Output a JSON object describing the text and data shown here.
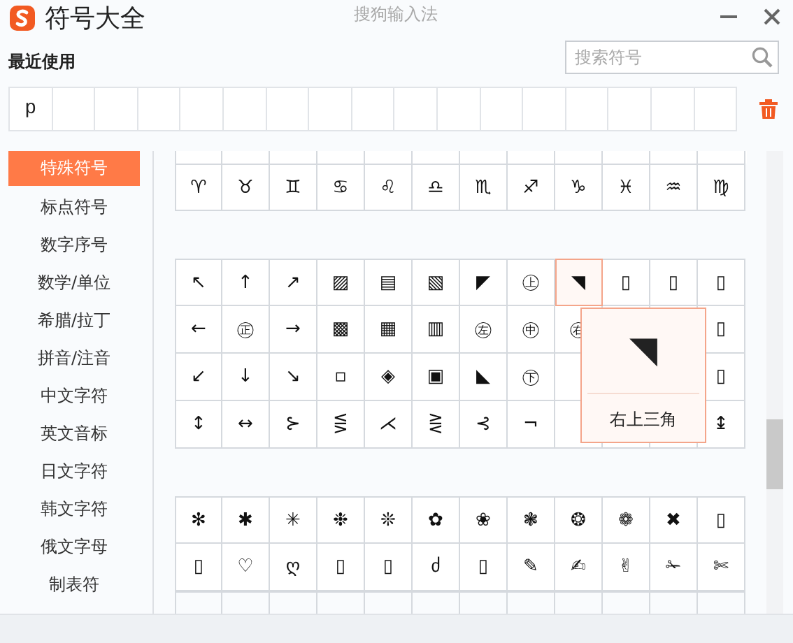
{
  "window": {
    "title": "符号大全",
    "app_name": "搜狗输入法"
  },
  "recent": {
    "label": "最近使用",
    "symbols": [
      "p"
    ]
  },
  "search": {
    "placeholder": "搜索符号"
  },
  "sidebar": {
    "items": [
      {
        "label": "特殊符号",
        "selected": true
      },
      {
        "label": "标点符号",
        "selected": false
      },
      {
        "label": "数字序号",
        "selected": false
      },
      {
        "label": "数学/单位",
        "selected": false
      },
      {
        "label": "希腊/拉丁",
        "selected": false
      },
      {
        "label": "拼音/注音",
        "selected": false
      },
      {
        "label": "中文字符",
        "selected": false
      },
      {
        "label": "英文音标",
        "selected": false
      },
      {
        "label": "日文字符",
        "selected": false
      },
      {
        "label": "韩文字符",
        "selected": false
      },
      {
        "label": "俄文字母",
        "selected": false
      },
      {
        "label": "制表符",
        "selected": false
      }
    ]
  },
  "sections": [
    {
      "rows": [
        [
          {
            "symbol": "♈",
            "selected": false
          },
          {
            "symbol": "♉",
            "selected": false
          },
          {
            "symbol": "♊",
            "selected": false
          },
          {
            "symbol": "♋",
            "selected": false
          },
          {
            "symbol": "♌",
            "selected": false
          },
          {
            "symbol": "♎",
            "selected": false
          },
          {
            "symbol": "♏",
            "selected": false
          },
          {
            "symbol": "♐",
            "selected": false
          },
          {
            "symbol": "♑",
            "selected": false
          },
          {
            "symbol": "♓",
            "selected": false
          },
          {
            "symbol": "♒",
            "selected": false
          },
          {
            "symbol": "♍",
            "selected": false
          }
        ]
      ]
    },
    {
      "rows": [
        [
          {
            "symbol": "↖",
            "selected": false
          },
          {
            "symbol": "↑",
            "selected": false
          },
          {
            "symbol": "↗",
            "selected": false
          },
          {
            "symbol": "▨",
            "selected": false
          },
          {
            "symbol": "▤",
            "selected": false
          },
          {
            "symbol": "▧",
            "selected": false
          },
          {
            "symbol": "◤",
            "selected": false
          },
          {
            "symbol": "㊤",
            "selected": false
          },
          {
            "symbol": "◥",
            "selected": true
          },
          {
            "symbol": "▯",
            "selected": false
          },
          {
            "symbol": "▯",
            "selected": false
          },
          {
            "symbol": "▯",
            "selected": false
          }
        ],
        [
          {
            "symbol": "←",
            "selected": false
          },
          {
            "symbol": "㊣",
            "selected": false
          },
          {
            "symbol": "→",
            "selected": false
          },
          {
            "symbol": "▩",
            "selected": false
          },
          {
            "symbol": "▦",
            "selected": false
          },
          {
            "symbol": "▥",
            "selected": false
          },
          {
            "symbol": "㊧",
            "selected": false
          },
          {
            "symbol": "㊥",
            "selected": false
          },
          {
            "symbol": "㊨",
            "selected": false
          },
          null,
          null,
          {
            "symbol": "▯",
            "selected": false
          }
        ],
        [
          {
            "symbol": "↙",
            "selected": false
          },
          {
            "symbol": "↓",
            "selected": false
          },
          {
            "symbol": "↘",
            "selected": false
          },
          {
            "symbol": "▫",
            "selected": false
          },
          {
            "symbol": "◈",
            "selected": false
          },
          {
            "symbol": "▣",
            "selected": false
          },
          {
            "symbol": "◣",
            "selected": false
          },
          {
            "symbol": "㊦",
            "selected": false
          },
          null,
          null,
          null,
          {
            "symbol": "▯",
            "selected": false
          }
        ],
        [
          {
            "symbol": "↕",
            "selected": false
          },
          {
            "symbol": "↔",
            "selected": false
          },
          {
            "symbol": "⊱",
            "selected": false
          },
          {
            "symbol": "⋚",
            "selected": false
          },
          {
            "symbol": "⋌",
            "selected": false
          },
          {
            "symbol": "⋛",
            "selected": false
          },
          {
            "symbol": "⊰",
            "selected": false
          },
          {
            "symbol": "¬",
            "selected": false
          },
          null,
          null,
          null,
          {
            "symbol": "↨",
            "selected": false
          }
        ]
      ]
    },
    {
      "rows": [
        [
          {
            "symbol": "✻",
            "selected": false
          },
          {
            "symbol": "✱",
            "selected": false
          },
          {
            "symbol": "✳",
            "selected": false
          },
          {
            "symbol": "❉",
            "selected": false
          },
          {
            "symbol": "❊",
            "selected": false
          },
          {
            "symbol": "✿",
            "selected": false
          },
          {
            "symbol": "❀",
            "selected": false
          },
          {
            "symbol": "❃",
            "selected": false
          },
          {
            "symbol": "❂",
            "selected": false
          },
          {
            "symbol": "❁",
            "selected": false
          },
          {
            "symbol": "✖",
            "selected": false
          },
          {
            "symbol": "▯",
            "selected": false
          }
        ],
        [
          {
            "symbol": "▯",
            "selected": false
          },
          {
            "symbol": "♡",
            "selected": false
          },
          {
            "symbol": "ღ",
            "selected": false
          },
          {
            "symbol": "▯",
            "selected": false
          },
          {
            "symbol": "▯",
            "selected": false
          },
          {
            "symbol": "ძ",
            "selected": false
          },
          {
            "symbol": "▯",
            "selected": false
          },
          {
            "symbol": "✎",
            "selected": false
          },
          {
            "symbol": "✍",
            "selected": false
          },
          {
            "symbol": "✌",
            "selected": false
          },
          {
            "symbol": "✁",
            "selected": false
          },
          {
            "symbol": "✄",
            "selected": false
          }
        ]
      ]
    }
  ],
  "tooltip": {
    "symbol": "◥",
    "name": "右上三角"
  }
}
